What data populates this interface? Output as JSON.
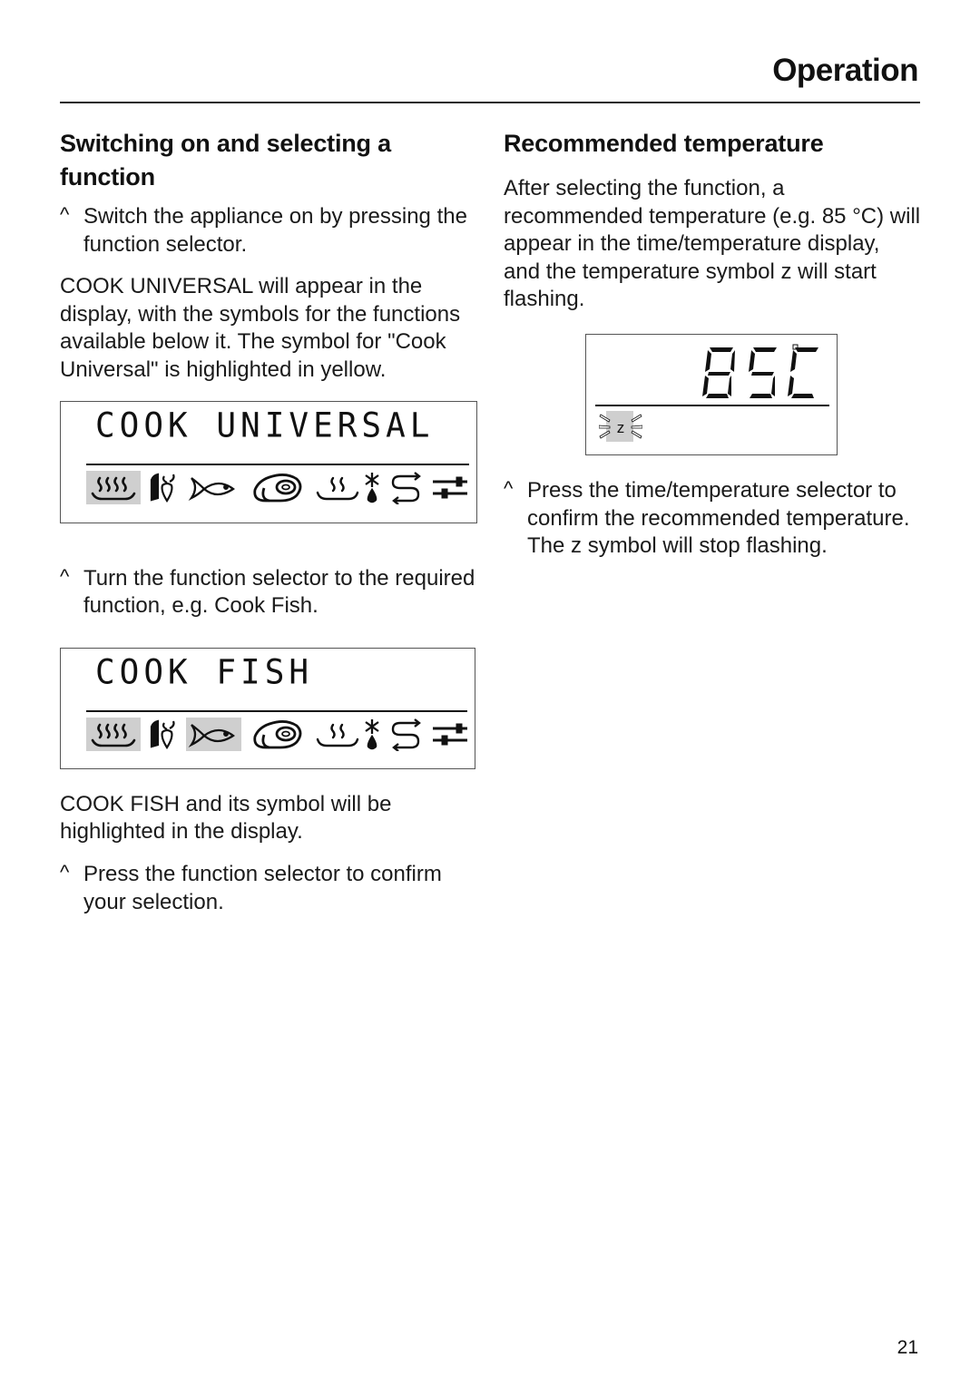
{
  "header": {
    "title": "Operation"
  },
  "left": {
    "heading": "Switching on and selecting a function",
    "step1": {
      "bullet": "^",
      "text": "Switch the appliance on by pressing the function selector."
    },
    "para1": "COOK UNIVERSAL will appear in the display, with the symbols for the functions available below it. The symbol for \"Cook Universal\" is highlighted in yellow.",
    "display1": {
      "text": "COOK UNIVERSAL",
      "highlighted": [
        "cook-universal"
      ]
    },
    "step2": {
      "bullet": "^",
      "text": "Turn the function selector to the required function, e.g. Cook Fish."
    },
    "display2": {
      "text": "COOK FISH",
      "highlighted": [
        "cook-universal",
        "cook-fish"
      ]
    },
    "para2": "COOK FISH and its symbol will be highlighted in the display.",
    "step3": {
      "bullet": "^",
      "text": "Press the function selector to confirm your selection."
    }
  },
  "function_icons": [
    "steam-universal-icon",
    "vegetables-icon",
    "fish-icon",
    "meat-icon",
    "reheat-icon",
    "defrost-icon",
    "menu-cook-icon",
    "settings-icon"
  ],
  "right": {
    "heading": "Recommended temperature",
    "para1": "After selecting the function, a recommended temperature (e.g. 85 °C) will appear in the time/temperature display, and the temperature symbol z will start flashing.",
    "display": {
      "value": "85",
      "unit": "C",
      "symbol": "z"
    },
    "step1": {
      "bullet": "^",
      "text": "Press the time/temperature selector to confirm the recommended temperature. The z symbol will stop flashing."
    }
  },
  "footer": {
    "page_number": "21"
  },
  "colors": {
    "highlight": "#cfcfcf",
    "text": "#1a1a1a"
  }
}
